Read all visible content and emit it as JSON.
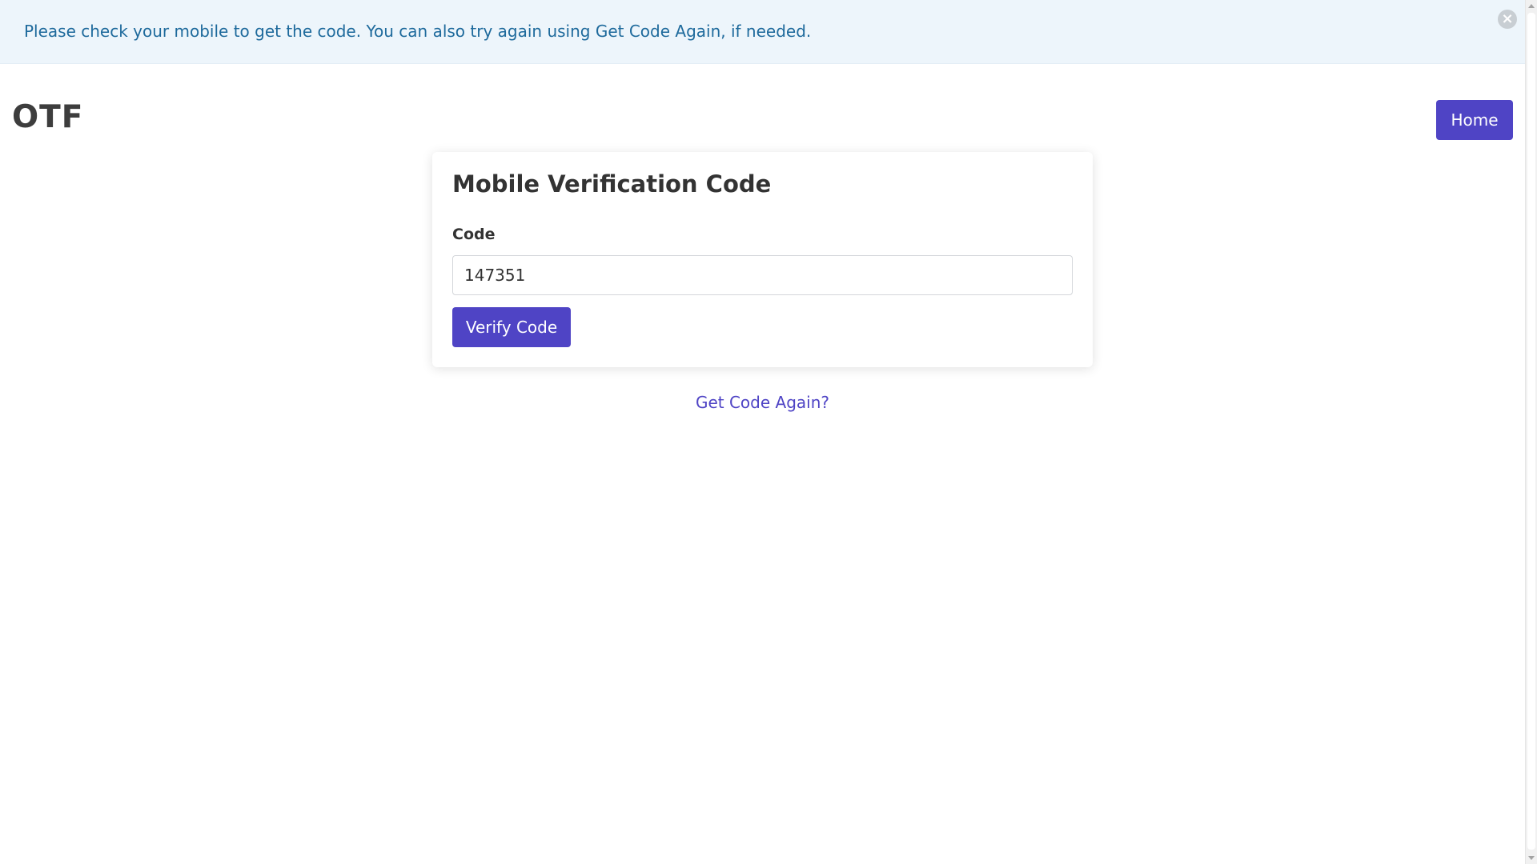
{
  "alert": {
    "message": "Please check your mobile to get the code. You can also try again using Get Code Again, if needed.",
    "close_symbol": "×"
  },
  "header": {
    "brand": "OTF",
    "home_label": "Home"
  },
  "card": {
    "title": "Mobile Verification Code",
    "code_label": "Code",
    "code_value": "147351",
    "verify_label": "Verify Code"
  },
  "links": {
    "get_code_again": "Get Code Again?"
  },
  "colors": {
    "primary": "#4f44c5",
    "alert_bg": "#edf5fb",
    "alert_text": "#1e6a9c"
  }
}
